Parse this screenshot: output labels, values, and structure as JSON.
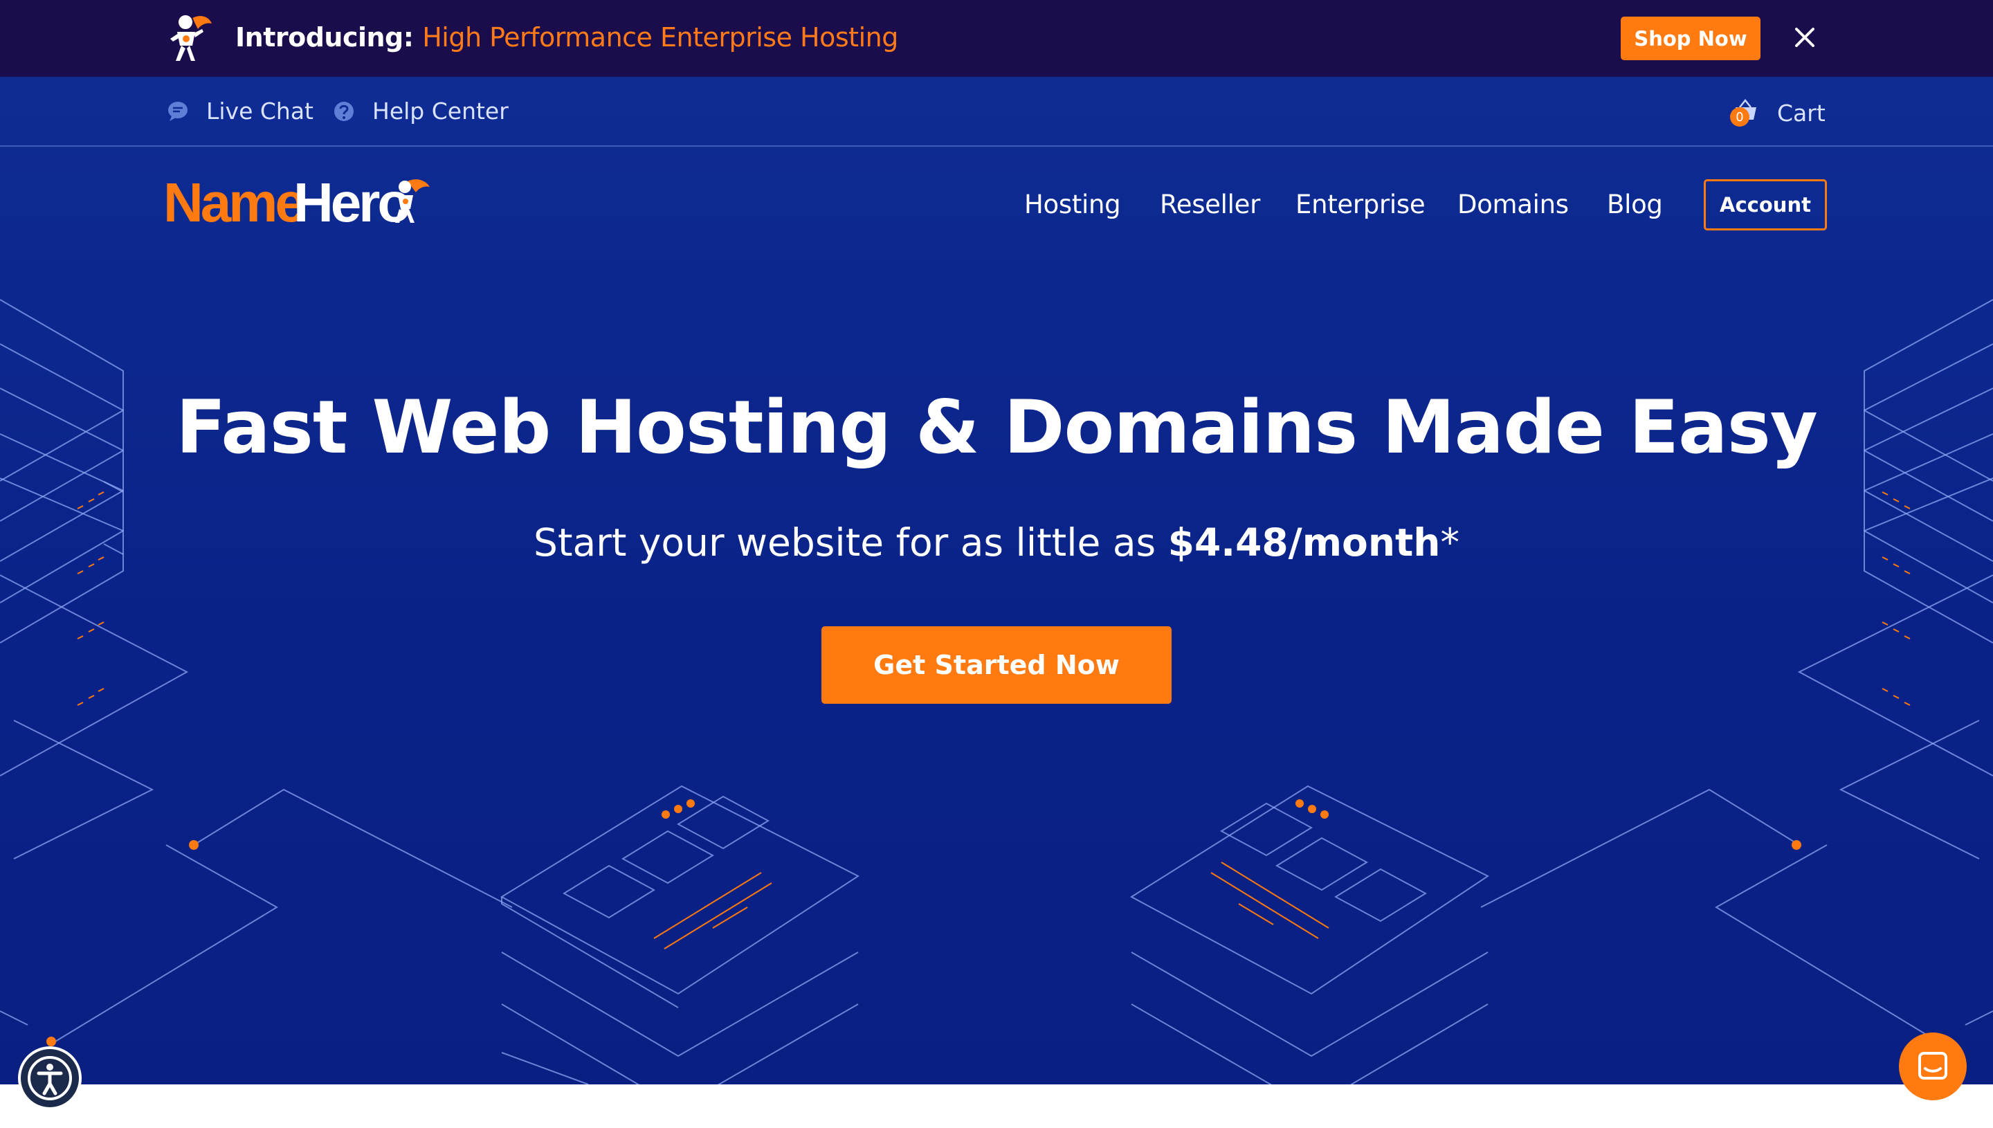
{
  "announcement": {
    "prefix": "Introducing:",
    "highlight": "High Performance Enterprise Hosting",
    "shop_label": "Shop Now",
    "close_icon": "close-icon"
  },
  "utility": {
    "live_chat": "Live Chat",
    "help_center": "Help Center",
    "cart": "Cart",
    "cart_count": "0"
  },
  "logo": {
    "name_part": "Name",
    "hero_part": "Hero"
  },
  "nav": {
    "items": [
      "Hosting",
      "Reseller",
      "Enterprise",
      "Domains",
      "Blog"
    ],
    "account": "Account"
  },
  "hero": {
    "headline": "Fast Web Hosting & Domains Made Easy",
    "sub_prefix": "Start your website for as little as ",
    "sub_price": "$4.48/month",
    "sub_suffix": "*",
    "cta": "Get Started Now"
  },
  "colors": {
    "accent": "#ff7a10",
    "announce_bg": "#1b0c4c",
    "hero_bg": "#0d2a92",
    "text": "#ffffff"
  },
  "icons": {
    "live_chat": "chat-bubble-icon",
    "help_center": "question-circle-icon",
    "cart": "basket-icon",
    "accessibility": "accessibility-icon",
    "support_chat": "chat-icon"
  }
}
